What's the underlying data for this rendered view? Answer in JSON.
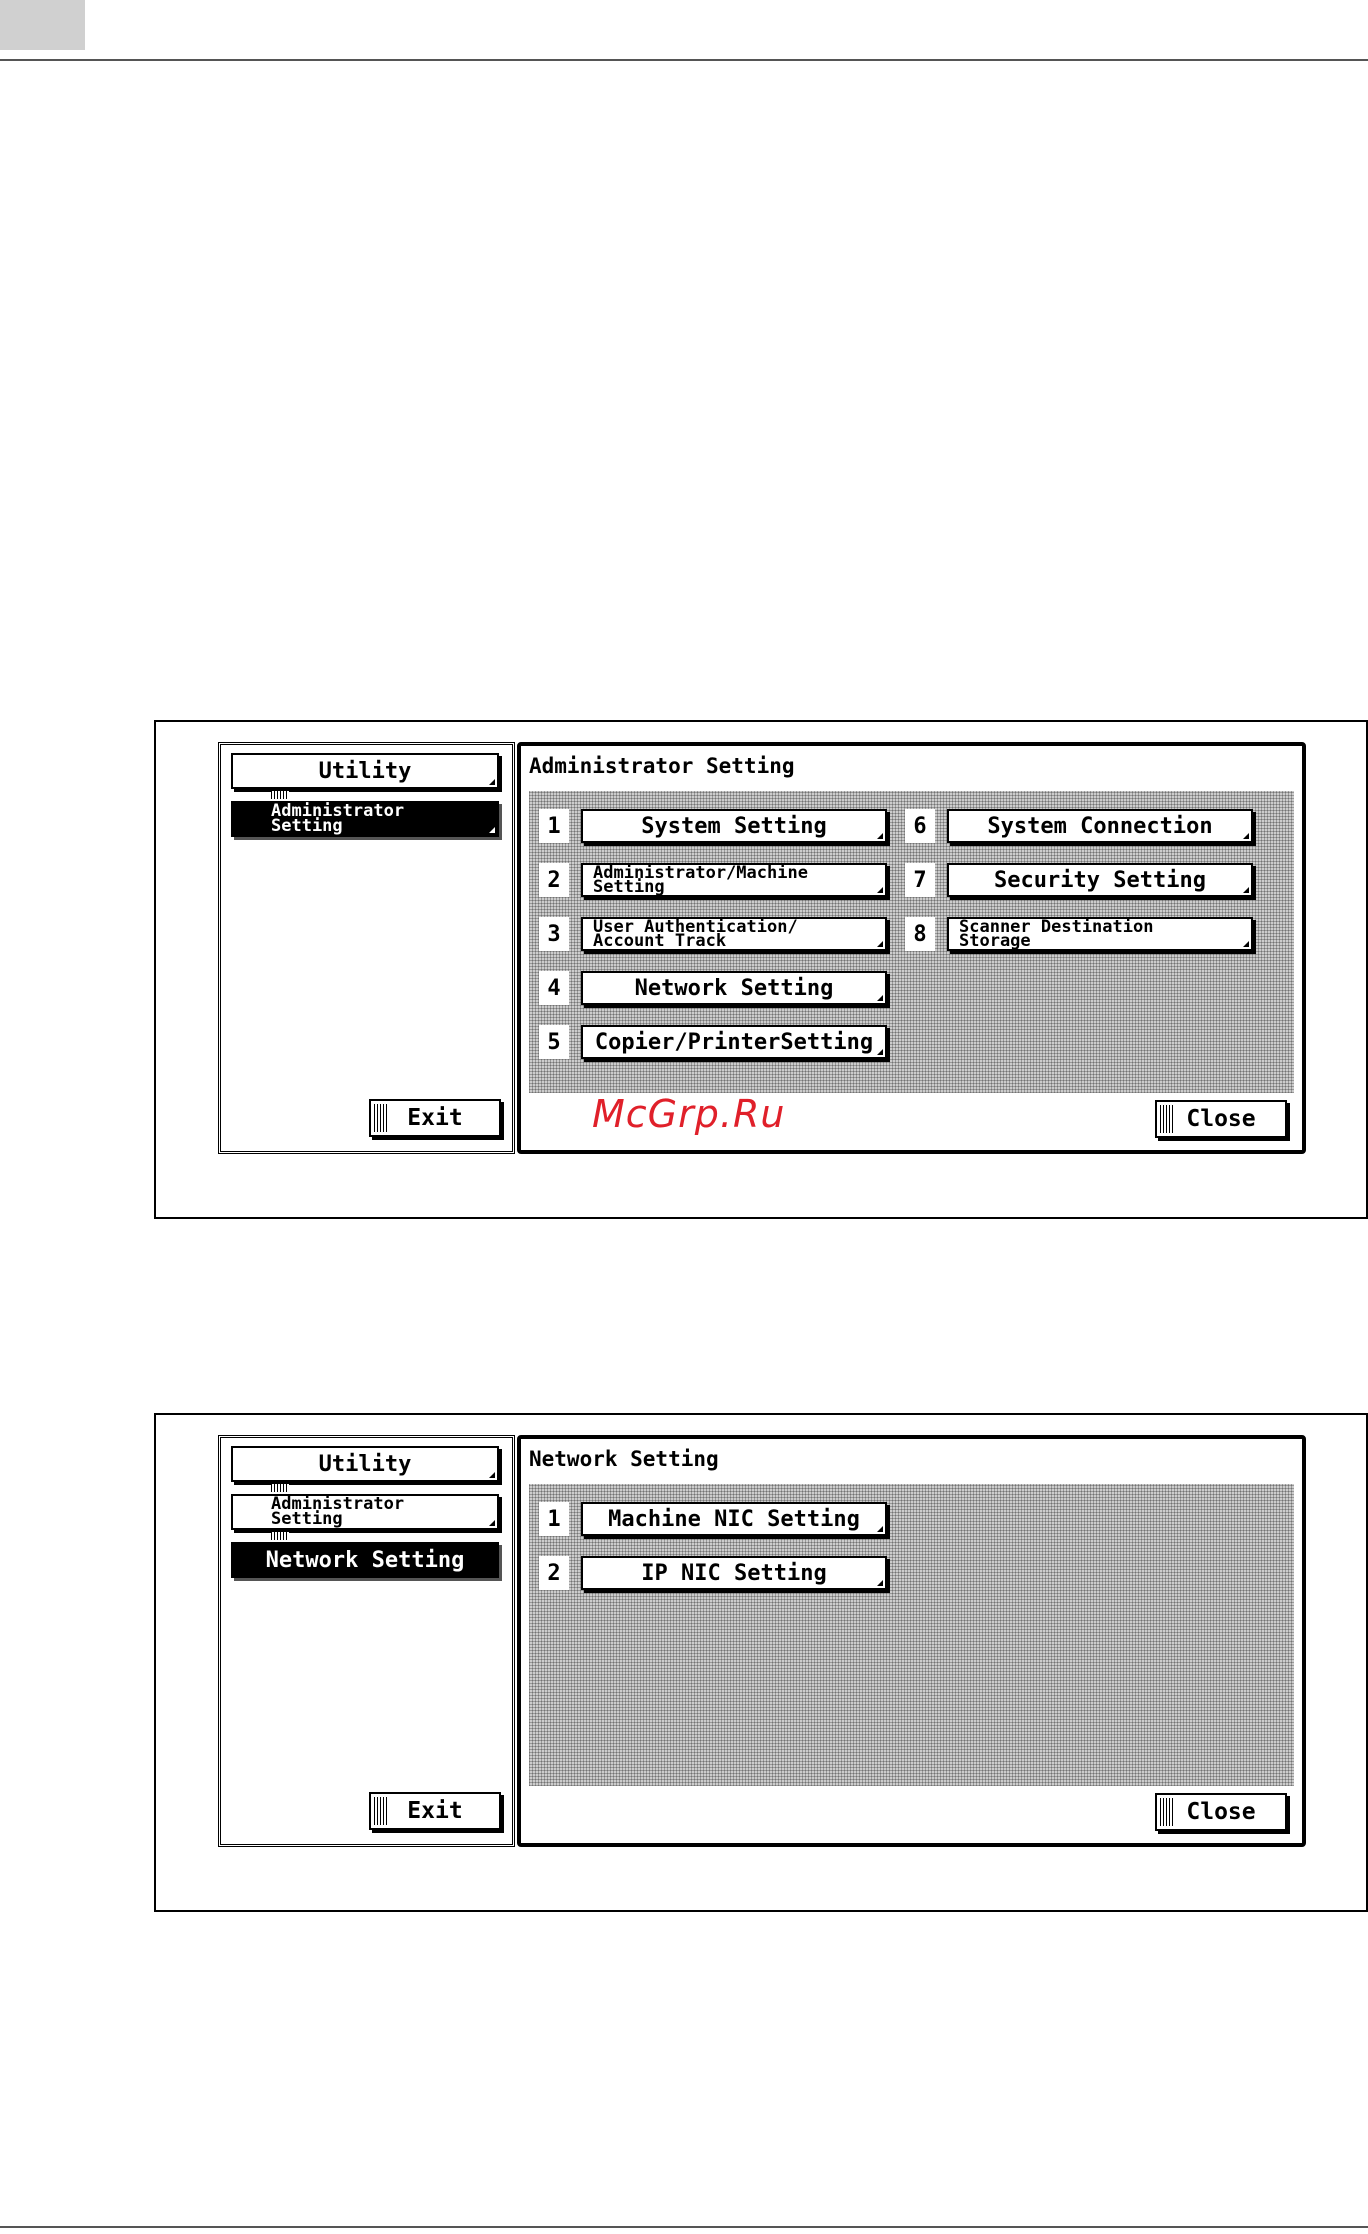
{
  "fig1": {
    "sidebar": {
      "utility_label": "Utility",
      "admin_label_line1": "Administrator",
      "admin_label_line2": "Setting",
      "exit_label": "Exit"
    },
    "panel": {
      "title": "Administrator Setting",
      "items": [
        {
          "num": "1",
          "label": "System Setting"
        },
        {
          "num": "2",
          "label_line1": "Administrator/Machine",
          "label_line2": "Setting"
        },
        {
          "num": "3",
          "label_line1": "User Authentication/",
          "label_line2": "Account Track"
        },
        {
          "num": "4",
          "label": "Network Setting"
        },
        {
          "num": "5",
          "label": "Copier/PrinterSetting"
        },
        {
          "num": "6",
          "label": "System Connection"
        },
        {
          "num": "7",
          "label": "Security Setting"
        },
        {
          "num": "8",
          "label_line1": "Scanner Destination",
          "label_line2": "Storage"
        }
      ],
      "close_label": "Close"
    }
  },
  "fig2": {
    "sidebar": {
      "utility_label": "Utility",
      "admin_label_line1": "Administrator",
      "admin_label_line2": "Setting",
      "network_label": "Network Setting",
      "exit_label": "Exit"
    },
    "panel": {
      "title": "Network Setting",
      "items": [
        {
          "num": "1",
          "label": "Machine NIC Setting"
        },
        {
          "num": "2",
          "label": "IP NIC Setting"
        }
      ],
      "close_label": "Close"
    }
  },
  "watermark": "McGrp.Ru"
}
